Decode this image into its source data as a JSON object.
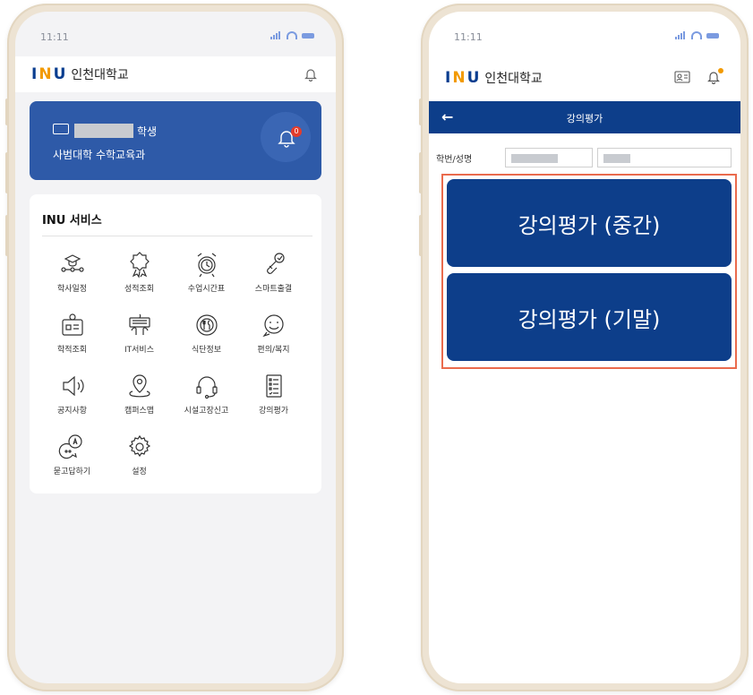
{
  "left_phone": {
    "status": {
      "time": "11:11"
    },
    "header": {
      "logo_text": "INU",
      "logo_accent": "U",
      "school_name": "인천대학교"
    },
    "user_card": {
      "role": "학생",
      "department": "사범대학 수학교육과",
      "badge_count": "0"
    },
    "services": {
      "title": "INU 서비스",
      "items": [
        {
          "label": "학사일정",
          "icon": "calendar-hat-icon"
        },
        {
          "label": "성적조회",
          "icon": "award-medal-icon"
        },
        {
          "label": "수업시간표",
          "icon": "alarm-clock-icon"
        },
        {
          "label": "스마트출결",
          "icon": "check-link-icon"
        },
        {
          "label": "학적조회",
          "icon": "id-card-icon"
        },
        {
          "label": "IT서비스",
          "icon": "keyboard-hands-icon"
        },
        {
          "label": "식단정보",
          "icon": "plate-cutlery-icon"
        },
        {
          "label": "편의/복지",
          "icon": "smile-chat-icon"
        },
        {
          "label": "공지사항",
          "icon": "speaker-icon"
        },
        {
          "label": "캠퍼스맵",
          "icon": "map-pin-icon"
        },
        {
          "label": "시설고장신고",
          "icon": "headset-icon"
        },
        {
          "label": "강의평가",
          "icon": "checklist-icon"
        },
        {
          "label": "묻고답하기",
          "icon": "qa-bubble-icon"
        },
        {
          "label": "설정",
          "icon": "gear-icon"
        }
      ]
    }
  },
  "right_phone": {
    "status": {
      "time": "11:11"
    },
    "header": {
      "school_name": "인천대학교"
    },
    "nav": {
      "title": "강의평가"
    },
    "id_row": {
      "label": "학번/성명"
    },
    "buttons": {
      "midterm": "강의평가 (중간)",
      "final": "강의평가 (기말)"
    }
  },
  "colors": {
    "navy": "#0d3e8a",
    "card_blue": "#2e5aa8",
    "highlight": "#ea6b4d",
    "badge": "#e23c2c"
  }
}
